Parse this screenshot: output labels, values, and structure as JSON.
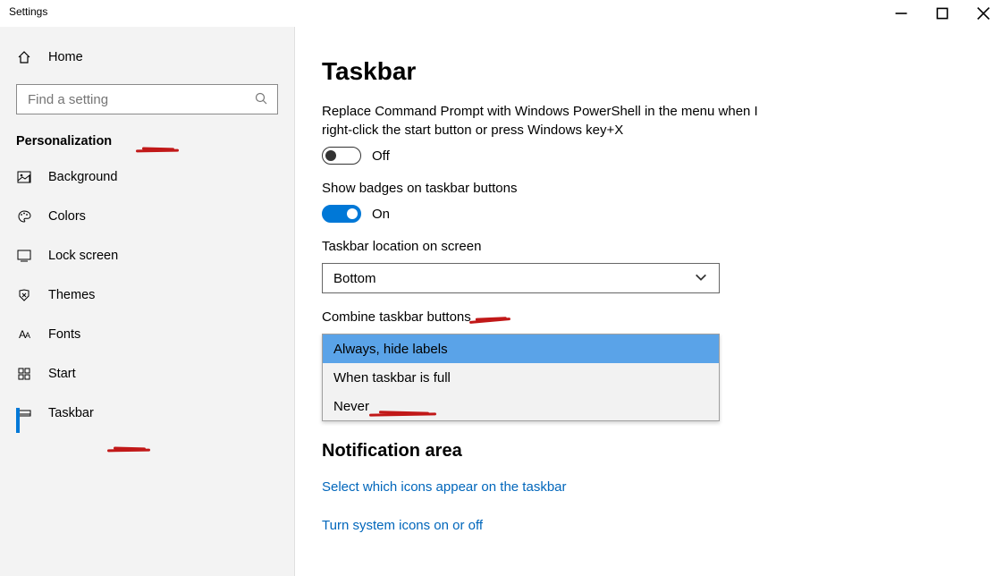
{
  "window": {
    "title": "Settings"
  },
  "sidebar": {
    "home": "Home",
    "search_placeholder": "Find a setting",
    "section": "Personalization",
    "items": [
      {
        "label": "Background"
      },
      {
        "label": "Colors"
      },
      {
        "label": "Lock screen"
      },
      {
        "label": "Themes"
      },
      {
        "label": "Fonts"
      },
      {
        "label": "Start"
      },
      {
        "label": "Taskbar"
      }
    ]
  },
  "main": {
    "title": "Taskbar",
    "setting_powershell": {
      "label": "Replace Command Prompt with Windows PowerShell in the menu when I right-click the start button or press Windows key+X",
      "state": "Off",
      "on": false
    },
    "setting_badges": {
      "label": "Show badges on taskbar buttons",
      "state": "On",
      "on": true
    },
    "setting_location": {
      "label": "Taskbar location on screen",
      "value": "Bottom"
    },
    "setting_combine": {
      "label": "Combine taskbar buttons",
      "options": [
        "Always, hide labels",
        "When taskbar is full",
        "Never"
      ],
      "selected_index": 0
    },
    "notification_area": {
      "heading": "Notification area",
      "link1": "Select which icons appear on the taskbar",
      "link2": "Turn system icons on or off"
    }
  }
}
